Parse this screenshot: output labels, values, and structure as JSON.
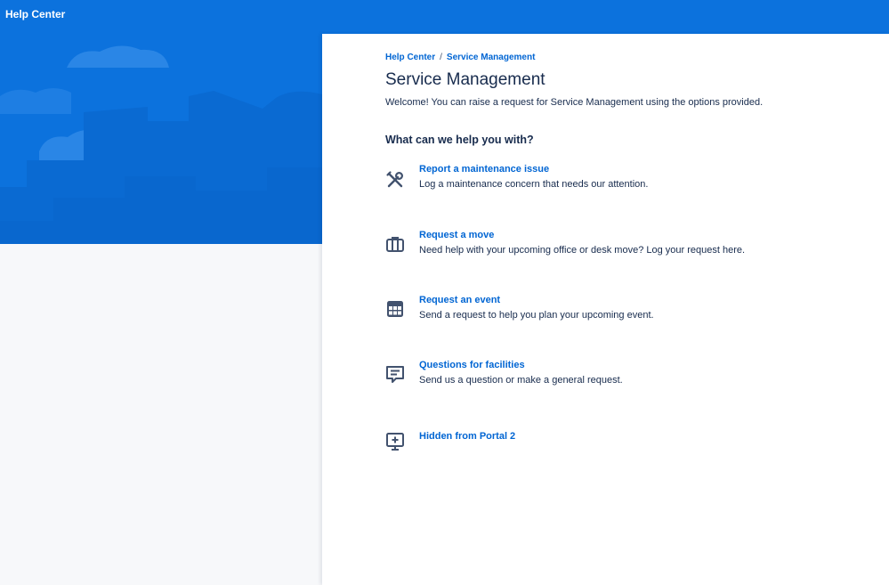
{
  "header": {
    "title": "Help Center"
  },
  "breadcrumb": {
    "home": "Help Center",
    "separator": "/",
    "current": "Service Management"
  },
  "portal": {
    "title": "Service Management",
    "welcome": "Welcome! You can raise a request for Service Management using the options provided.",
    "section_heading": "What can we help you with?"
  },
  "requests": [
    {
      "title": "Report a maintenance issue",
      "description": "Log a maintenance concern that needs our attention.",
      "icon": "tools-icon"
    },
    {
      "title": "Request a move",
      "description": "Need help with your upcoming office or desk move? Log your request here.",
      "icon": "briefcase-icon"
    },
    {
      "title": "Request an event",
      "description": "Send a request to help you plan your upcoming event.",
      "icon": "calendar-grid-icon"
    },
    {
      "title": "Questions for facilities",
      "description": "Send us a question or make a general request.",
      "icon": "message-icon"
    },
    {
      "title": "Hidden from Portal 2",
      "description": "",
      "icon": "monitor-add-icon"
    }
  ],
  "colors": {
    "brand": "#0c72dd",
    "link": "#0065d3",
    "text": "#172b4d",
    "icon": "#42526e"
  }
}
